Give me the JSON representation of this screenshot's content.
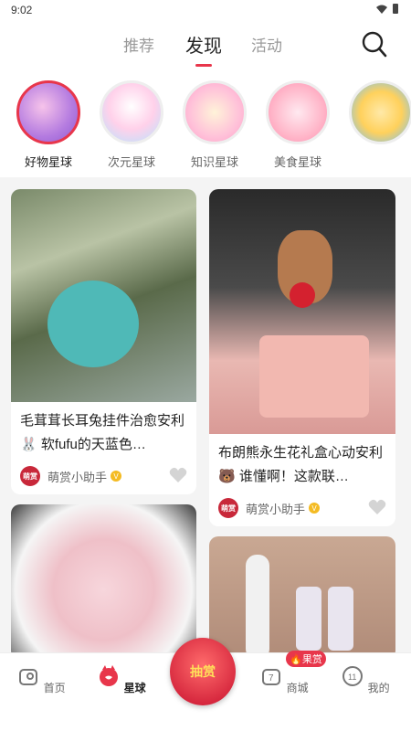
{
  "status": {
    "time": "9:02"
  },
  "topnav": {
    "tabs": [
      "推荐",
      "发现",
      "活动"
    ],
    "active": "发现"
  },
  "planets": [
    {
      "label": "好物星球",
      "active": true,
      "colors": [
        "#b47be0",
        "#f08bb6"
      ]
    },
    {
      "label": "次元星球",
      "active": false,
      "colors": [
        "#ffd1ea",
        "#b7e3ff"
      ]
    },
    {
      "label": "知识星球",
      "active": false,
      "colors": [
        "#ff9fc7",
        "#ffe3b0"
      ]
    },
    {
      "label": "美食星球",
      "active": false,
      "colors": [
        "#ff8fb1",
        "#ffd9e8"
      ]
    },
    {
      "label": "",
      "active": false,
      "colors": [
        "#ffd15c",
        "#6ec1ff"
      ]
    }
  ],
  "cards": [
    {
      "title": "毛茸茸长耳兔挂件治愈安利🐰 软fufu的天蓝色…",
      "author": "萌赏小助手",
      "avatar_text": "萌赏"
    },
    {
      "title": "布朗熊永生花礼盒心动安利🐻 谁懂啊！这款联…",
      "author": "萌赏小助手",
      "avatar_text": "萌赏"
    }
  ],
  "bottomnav": {
    "items": [
      "首页",
      "星球",
      "商城",
      "我的"
    ],
    "lottery": "抽赏",
    "guo_badge": "🔥果赏"
  },
  "colors": {
    "accent": "#e8364b"
  }
}
